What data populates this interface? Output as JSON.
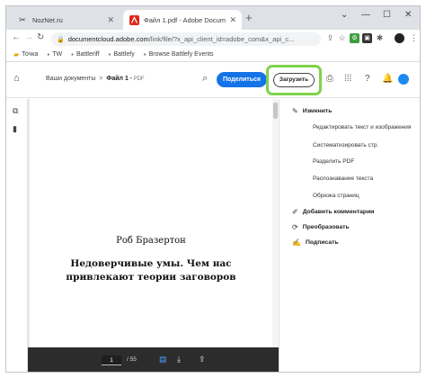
{
  "browser": {
    "tabs": [
      {
        "title": "NozNet.ru",
        "icon": "scissors-icon"
      },
      {
        "title": "Файл 1.pdf - Adobe Document",
        "icon": "acrobat-icon"
      }
    ],
    "url_host": "documentcloud.adobe.com",
    "url_path": "/link/file/?x_api_client_id=adobe_com&x_api_c...",
    "bookmarks": [
      {
        "label": "Точка",
        "icon": "folder-icon"
      },
      {
        "label": "TW",
        "icon": "page-icon"
      },
      {
        "label": "Battleriff",
        "icon": "page-icon"
      },
      {
        "label": "Battlefy",
        "icon": "page-icon"
      },
      {
        "label": "Browse Battlefy Events",
        "icon": "page-icon"
      }
    ]
  },
  "app": {
    "breadcrumb_root": "Ваши документы",
    "breadcrumb_sep": ">",
    "file_name": "Файл 1",
    "file_type": "PDF",
    "share_label": "Поделиться",
    "upload_label": "Загрузить"
  },
  "document": {
    "author": "Роб  Бразертон",
    "title_line1": "Недоверчивые умы. Чем нас",
    "title_line2": "привлекают теории заговоров",
    "current_page": "1",
    "total_pages": "/ 55"
  },
  "panel": {
    "edit_header": "Изменить",
    "edit_items": [
      "Редактировать текст и изображения",
      "Систематизировать стр.",
      "Разделить PDF",
      "Распознавание текста",
      "Обрезка страниц"
    ],
    "comment": "Добавить комментарии",
    "convert": "Преобразовать",
    "sign": "Подписать"
  },
  "colors": {
    "share_button": "#1473e6",
    "highlight": "#7ed24a",
    "page_bar": "#2c2c2c"
  }
}
